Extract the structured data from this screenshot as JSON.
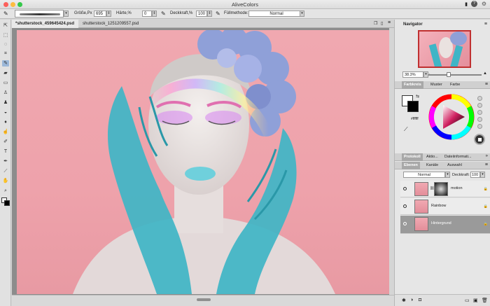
{
  "app": {
    "title": "AliveColors"
  },
  "options_bar": {
    "size_label": "Größe,Px",
    "size_value": "695",
    "hardness_label": "Härte,%",
    "hardness_value": "0",
    "opacity_label": "Deckkraft,%",
    "opacity_value": "100",
    "fill_label": "Füllmethode:",
    "fill_value": "Normal"
  },
  "documents": [
    {
      "name": "*shutterstock_459645424.psd",
      "active": true
    },
    {
      "name": "shutterstock_1251209557.psd",
      "active": false
    }
  ],
  "navigator": {
    "title": "Navigator",
    "zoom": "38.3%"
  },
  "color_panel": {
    "tabs": [
      "Farbkreis",
      "Muster",
      "Farbe"
    ],
    "hex": "#ffffff"
  },
  "bottom_tabs": {
    "tabs": [
      "Protokoll",
      "Aktio...",
      "Dateiinformati..."
    ]
  },
  "layers_panel": {
    "tabs": [
      "Ebenen",
      "Kanäle",
      "Auswahl"
    ],
    "blend_mode": "Normal",
    "opacity_label": "Deckkraft:",
    "opacity_value": "100",
    "layers": [
      {
        "name": "motion",
        "selected": false
      },
      {
        "name": "Rainbow",
        "selected": false
      },
      {
        "name": "Hintergrund",
        "selected": true
      }
    ]
  },
  "colors": {
    "accent": "#9bb7d8",
    "selection": "#9a9a9a",
    "canvas_pink": "#f0a8b0",
    "paint_teal": "#3fb5c6"
  }
}
